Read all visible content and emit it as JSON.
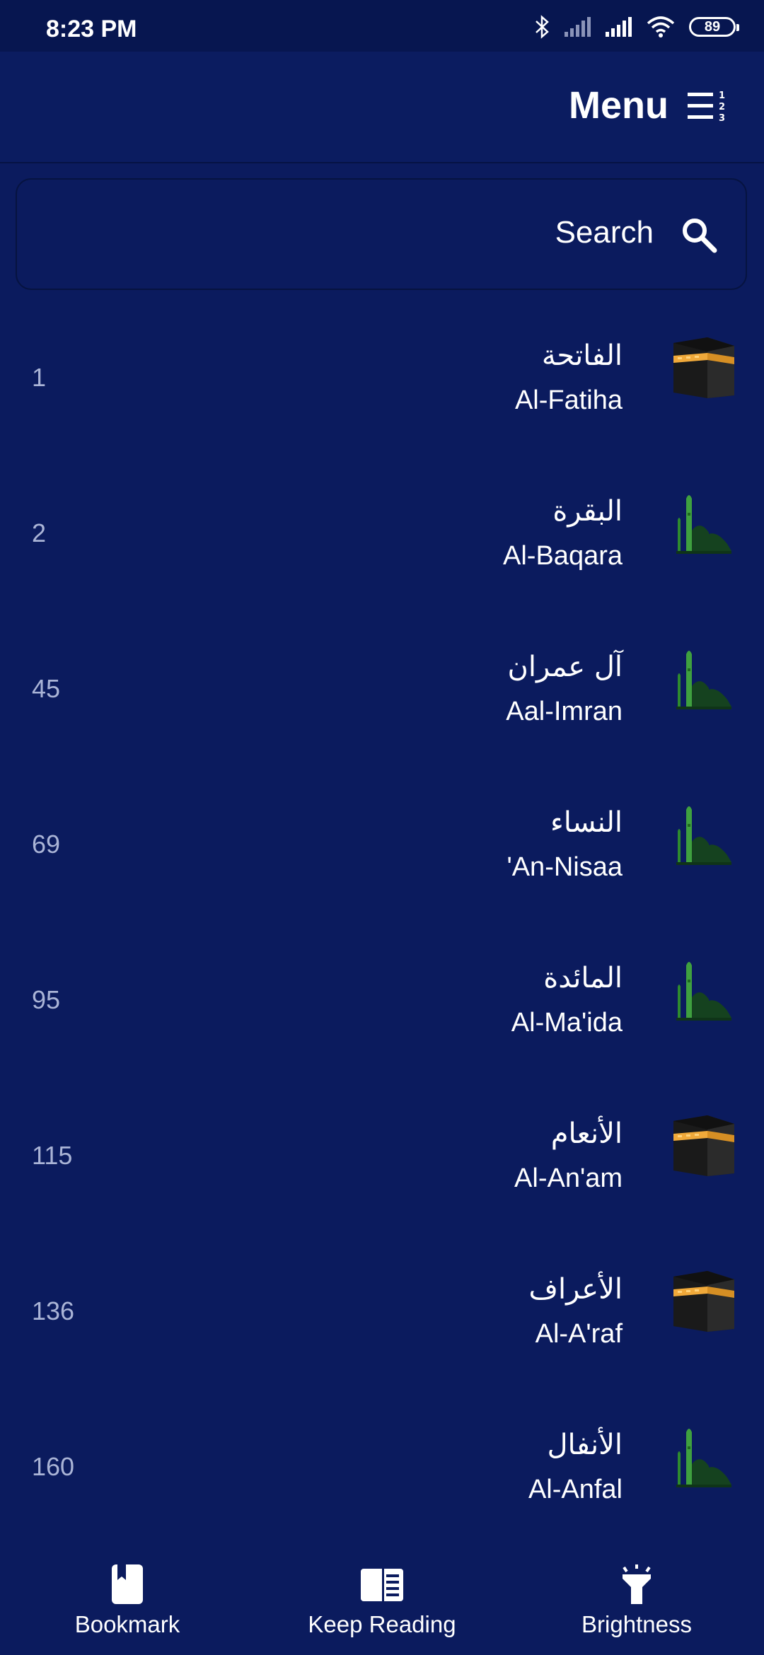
{
  "status_bar": {
    "time": "8:23 PM",
    "battery": "89",
    "icons": [
      "bluetooth-icon",
      "signal-icon",
      "signal-icon",
      "wifi-icon",
      "battery-icon"
    ]
  },
  "header": {
    "title": "Menu",
    "menu_icon": "numbered-list-icon"
  },
  "search": {
    "placeholder": "Search",
    "icon": "search-icon"
  },
  "surahs": [
    {
      "arabic": "الفاتحة",
      "latin": "Al-Fatiha",
      "page": "1",
      "type": "kaaba-icon"
    },
    {
      "arabic": "البقرة",
      "latin": "Al-Baqara",
      "page": "2",
      "type": "mosque-icon"
    },
    {
      "arabic": "آل عمران",
      "latin": "Aal-Imran",
      "page": "45",
      "type": "mosque-icon"
    },
    {
      "arabic": "النساء",
      "latin": "'An-Nisaa",
      "page": "69",
      "type": "mosque-icon"
    },
    {
      "arabic": "المائدة",
      "latin": "Al-Ma'ida",
      "page": "95",
      "type": "mosque-icon"
    },
    {
      "arabic": "الأنعام",
      "latin": "Al-An'am",
      "page": "115",
      "type": "kaaba-icon"
    },
    {
      "arabic": "الأعراف",
      "latin": "Al-A'raf",
      "page": "136",
      "type": "kaaba-icon"
    },
    {
      "arabic": "الأنفال",
      "latin": "Al-Anfal",
      "page": "160",
      "type": "mosque-icon"
    }
  ],
  "bottom_nav": [
    {
      "label": "Bookmark",
      "icon": "bookmark-icon"
    },
    {
      "label": "Keep Reading",
      "icon": "book-open-icon"
    },
    {
      "label": "Brightness",
      "icon": "flashlight-icon"
    }
  ],
  "colors": {
    "background": "#0b1b5e",
    "status_bar": "#071650",
    "page_number": "#aab4d6",
    "kaaba_gold": "#f0a93a",
    "mosque_green": "#2e8b2e"
  }
}
